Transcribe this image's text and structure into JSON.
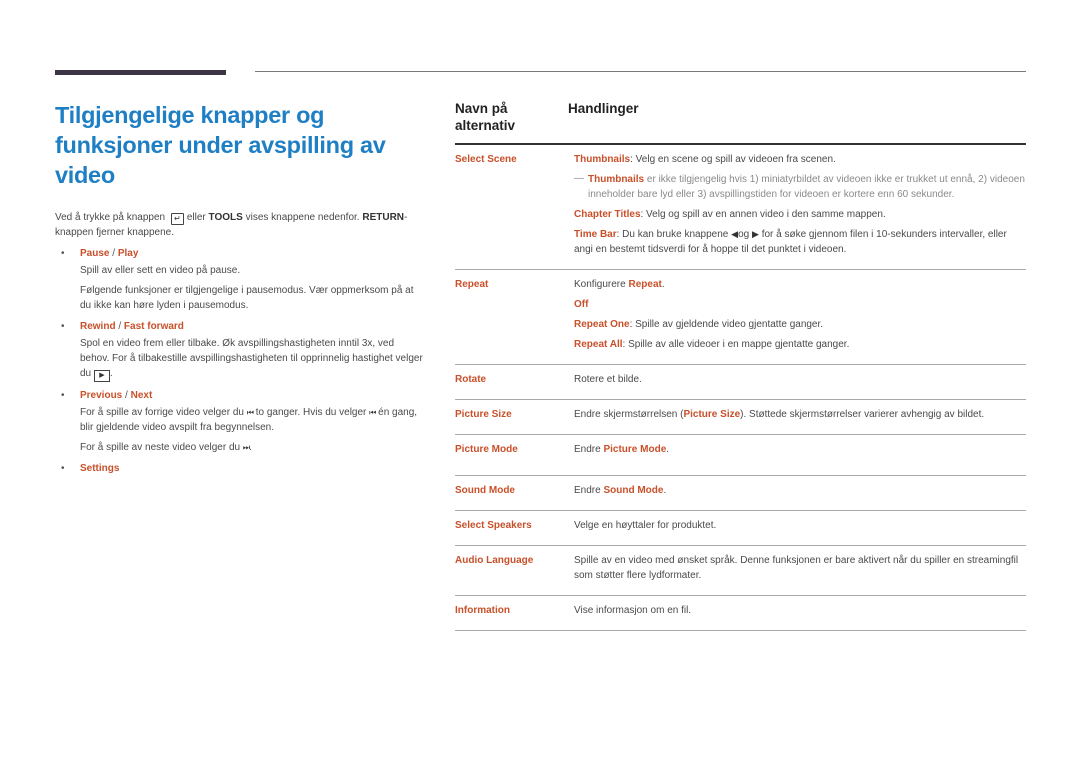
{
  "header": {
    "title": "Tilgjengelige knapper og funksjoner under avspilling av video"
  },
  "intro": {
    "part1": "Ved å trykke på knappen",
    "icon": "enter-icon",
    "part2": "eller",
    "tools": "TOOLS",
    "part3": "vises knappene nedenfor.",
    "return": "RETURN",
    "part4": "-knappen fjerner knappene."
  },
  "functions": [
    {
      "title_a": "Pause",
      "sep": " / ",
      "title_b": "Play",
      "paragraphs": [
        "Spill av eller sett en video på pause.",
        "Følgende funksjoner er tilgjengelige i pausemodus. Vær oppmerksom på at du ikke kan høre lyden i pausemodus."
      ]
    },
    {
      "title_a": "Rewind",
      "sep": " / ",
      "title_b": "Fast forward",
      "p1": "Spol en video frem eller tilbake. Øk avspillingshastigheten inntil 3x, ved behov. For å tilbakestille avspillingshastigheten til opprinnelig hastighet velger du",
      "p1_icon": "▶",
      "p1_end": "."
    },
    {
      "title_a": "Previous",
      "sep": " / ",
      "title_b": "Next",
      "p1a": "For å spille av forrige video velger du",
      "p1_icon1": "⏮",
      "p1b": "to ganger. Hvis du velger",
      "p1_icon2": "⏮",
      "p1c": "én gang, blir gjeldende video avspilt fra begynnelsen.",
      "p2a": "For å spille av neste video velger du",
      "p2_icon": "⏭",
      "p2b": "."
    },
    {
      "title_a": "Settings"
    }
  ],
  "table": {
    "col1": "Navn på alternativ",
    "col2": "Handlinger",
    "select_scene": {
      "name": "Select Scene",
      "thumb_label": "Thumbnails",
      "thumb_text": ": Velg en scene og spill av videoen fra scenen.",
      "note_dash": "—",
      "note_label": "Thumbnails",
      "note_text": " er ikke tilgjengelig hvis 1) miniatyrbildet av videoen ikke er trukket ut ennå, 2) videoen inneholder bare lyd eller 3) avspillingstiden for videoen er kortere enn 60 sekunder.",
      "chapter_label": "Chapter Titles",
      "chapter_text": ": Velg og spill av en annen video i den samme mappen.",
      "timebar_label": "Time Bar",
      "timebar_a": ": Du kan bruke knappene",
      "timebar_left": "◀",
      "timebar_og": "og",
      "timebar_right": "▶",
      "timebar_b": "for å søke gjennom filen i 10-sekunders intervaller, eller angi en bestemt tidsverdi for å hoppe til det punktet i videoen."
    },
    "repeat": {
      "name": "Repeat",
      "l1a": "Konfigurere ",
      "l1b": "Repeat",
      "l1c": ".",
      "off": "Off",
      "one_label": "Repeat One",
      "one_text": ": Spille av gjeldende video gjentatte ganger.",
      "all_label": "Repeat All",
      "all_text": ": Spille av alle videoer i en mappe gjentatte ganger."
    },
    "rotate": {
      "name": "Rotate",
      "text": "Rotere et bilde."
    },
    "picture_size": {
      "name": "Picture Size",
      "a": "Endre skjermstørrelsen (",
      "b": "Picture Size",
      "c": "). Støttede skjermstørrelser varierer avhengig av bildet."
    },
    "picture_mode": {
      "name": "Picture Mode",
      "a": "Endre ",
      "b": "Picture Mode",
      "c": "."
    },
    "sound_mode": {
      "name": "Sound Mode",
      "a": "Endre ",
      "b": "Sound Mode",
      "c": "."
    },
    "select_speakers": {
      "name": "Select Speakers",
      "text": "Velge en høyttaler for produktet."
    },
    "audio_language": {
      "name": "Audio Language",
      "text": "Spille av en video med ønsket språk. Denne funksjonen er bare aktivert når du spiller en streamingfil som støtter flere lydformater."
    },
    "information": {
      "name": "Information",
      "text": "Vise informasjon om en fil."
    }
  },
  "colors": {
    "title_blue": "#1f7fc4",
    "accent_orange": "#c8502a",
    "bar_dark": "#3d3546"
  }
}
